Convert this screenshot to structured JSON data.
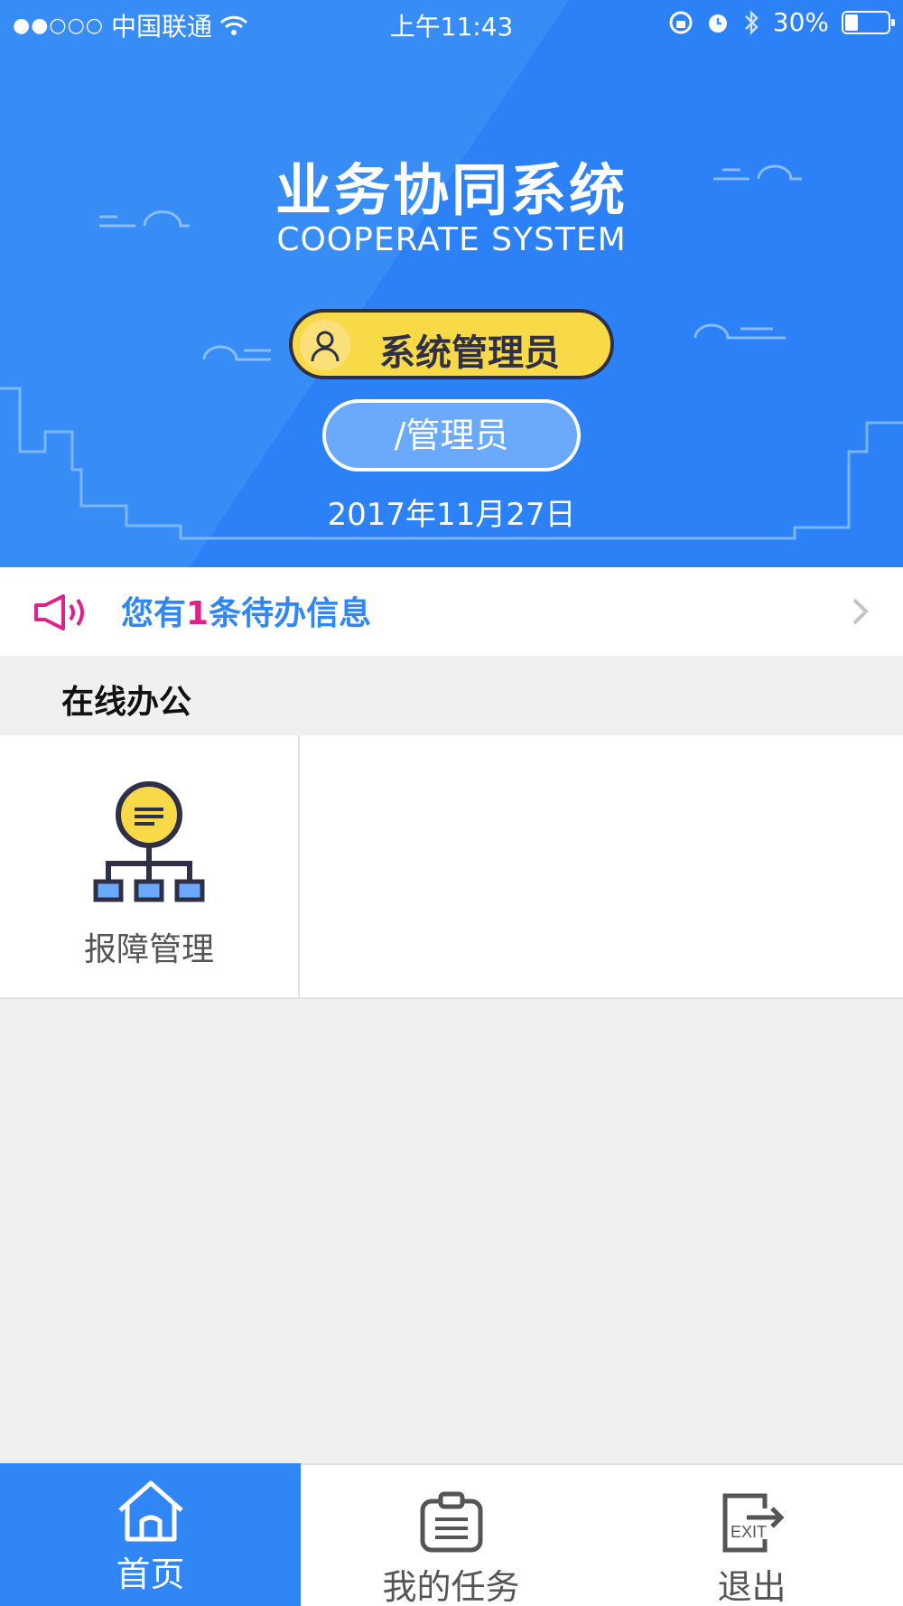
{
  "status_bar": {
    "signal_dots": "●●○○○",
    "carrier": "中国联通",
    "time": "上午11:43",
    "battery_percent": "30%"
  },
  "header": {
    "title_cn": "业务协同系统",
    "title_en": "COOPERATE SYSTEM",
    "role_label": "系统管理员",
    "sub_role_label": "/管理员",
    "date": "2017年11月27日"
  },
  "notice": {
    "prefix": "您有",
    "count": "1",
    "suffix": "条待办信息"
  },
  "section": {
    "title": "在线办公"
  },
  "tiles": [
    {
      "label": "报障管理",
      "icon": "org-chart-icon"
    }
  ],
  "tabbar": {
    "tabs": [
      {
        "label": "首页",
        "icon": "home-icon",
        "active": true
      },
      {
        "label": "我的任务",
        "icon": "clipboard-icon",
        "active": false
      },
      {
        "label": "退出",
        "icon": "exit-icon",
        "active": false
      }
    ]
  },
  "colors": {
    "brand_blue": "#2f86f4",
    "accent_yellow": "#f8d948",
    "accent_pink": "#e0218a"
  }
}
